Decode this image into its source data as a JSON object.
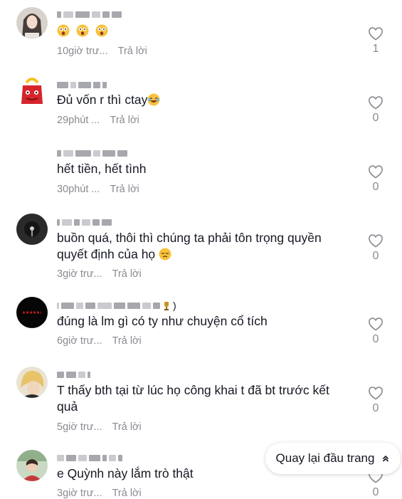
{
  "comments": [
    {
      "text": "",
      "emoji_count": 3,
      "time": "10giờ trước",
      "time_shown": "10giờ trư...",
      "reply": "Trả lời",
      "likes": "1"
    },
    {
      "text": "Đủ vốn r thì ctay",
      "emoji": "laugh-emoji",
      "time_shown": "29phút ...",
      "reply": "Trả lời",
      "likes": "0"
    },
    {
      "text": "hết tiền, hết tình",
      "time_shown": "30phút ...",
      "reply": "Trả lời",
      "likes": "0"
    },
    {
      "text": "buồn quá, thôi thì chúng ta phải tôn trọng quyền quyết định của họ",
      "emoji": "pensive-emoji",
      "time_shown": "3giờ trư...",
      "reply": "Trả lời",
      "likes": "0"
    },
    {
      "text": "đúng là lm gì có ty như chuyện cổ tích",
      "time_shown": "6giờ trư...",
      "reply": "Trả lời",
      "likes": "0"
    },
    {
      "text": "T thấy bth tại từ lúc họ công khai t đã bt trước kết quả",
      "time_shown": "5giờ trư...",
      "reply": "Trả lời",
      "likes": "0"
    },
    {
      "text": "e Quỳnh này lắm trò thật",
      "time_shown": "3giờ trư...",
      "reply": "Trả lời",
      "likes": "0"
    }
  ],
  "back_to_top": {
    "label": "Quay lại đầu trang"
  },
  "colors": {
    "text": "#161823",
    "muted": "#8a8b91",
    "background": "#ffffff"
  }
}
